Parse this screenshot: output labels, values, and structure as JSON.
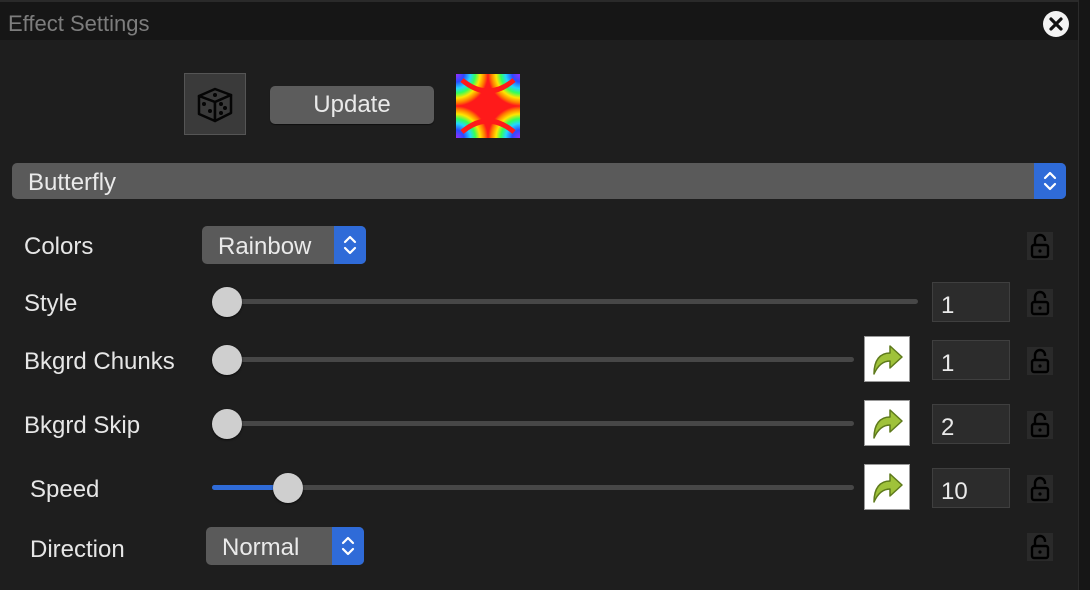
{
  "window": {
    "title": "Effect Settings"
  },
  "toolbar": {
    "update_label": "Update"
  },
  "effect": {
    "selected": "Butterfly"
  },
  "rows": {
    "colors": {
      "label": "Colors",
      "value": "Rainbow"
    },
    "style": {
      "label": "Style",
      "value": "1",
      "level": 0
    },
    "bkgrd_chunks": {
      "label": "Bkgrd Chunks",
      "value": "1",
      "level": 0
    },
    "bkgrd_skip": {
      "label": "Bkgrd Skip",
      "value": "2",
      "level": 0
    },
    "speed": {
      "label": "Speed",
      "value": "10",
      "level": 0.1
    },
    "direction": {
      "label": "Direction",
      "value": "Normal"
    }
  },
  "icons": {
    "close": "close-icon",
    "dice": "dice-icon",
    "lock": "lock-icon",
    "reset": "curved-arrow-icon",
    "stepper": "chevron-up-down-icon"
  },
  "colors": {
    "accent": "#2f6bd8",
    "background": "#1e1e1e"
  }
}
